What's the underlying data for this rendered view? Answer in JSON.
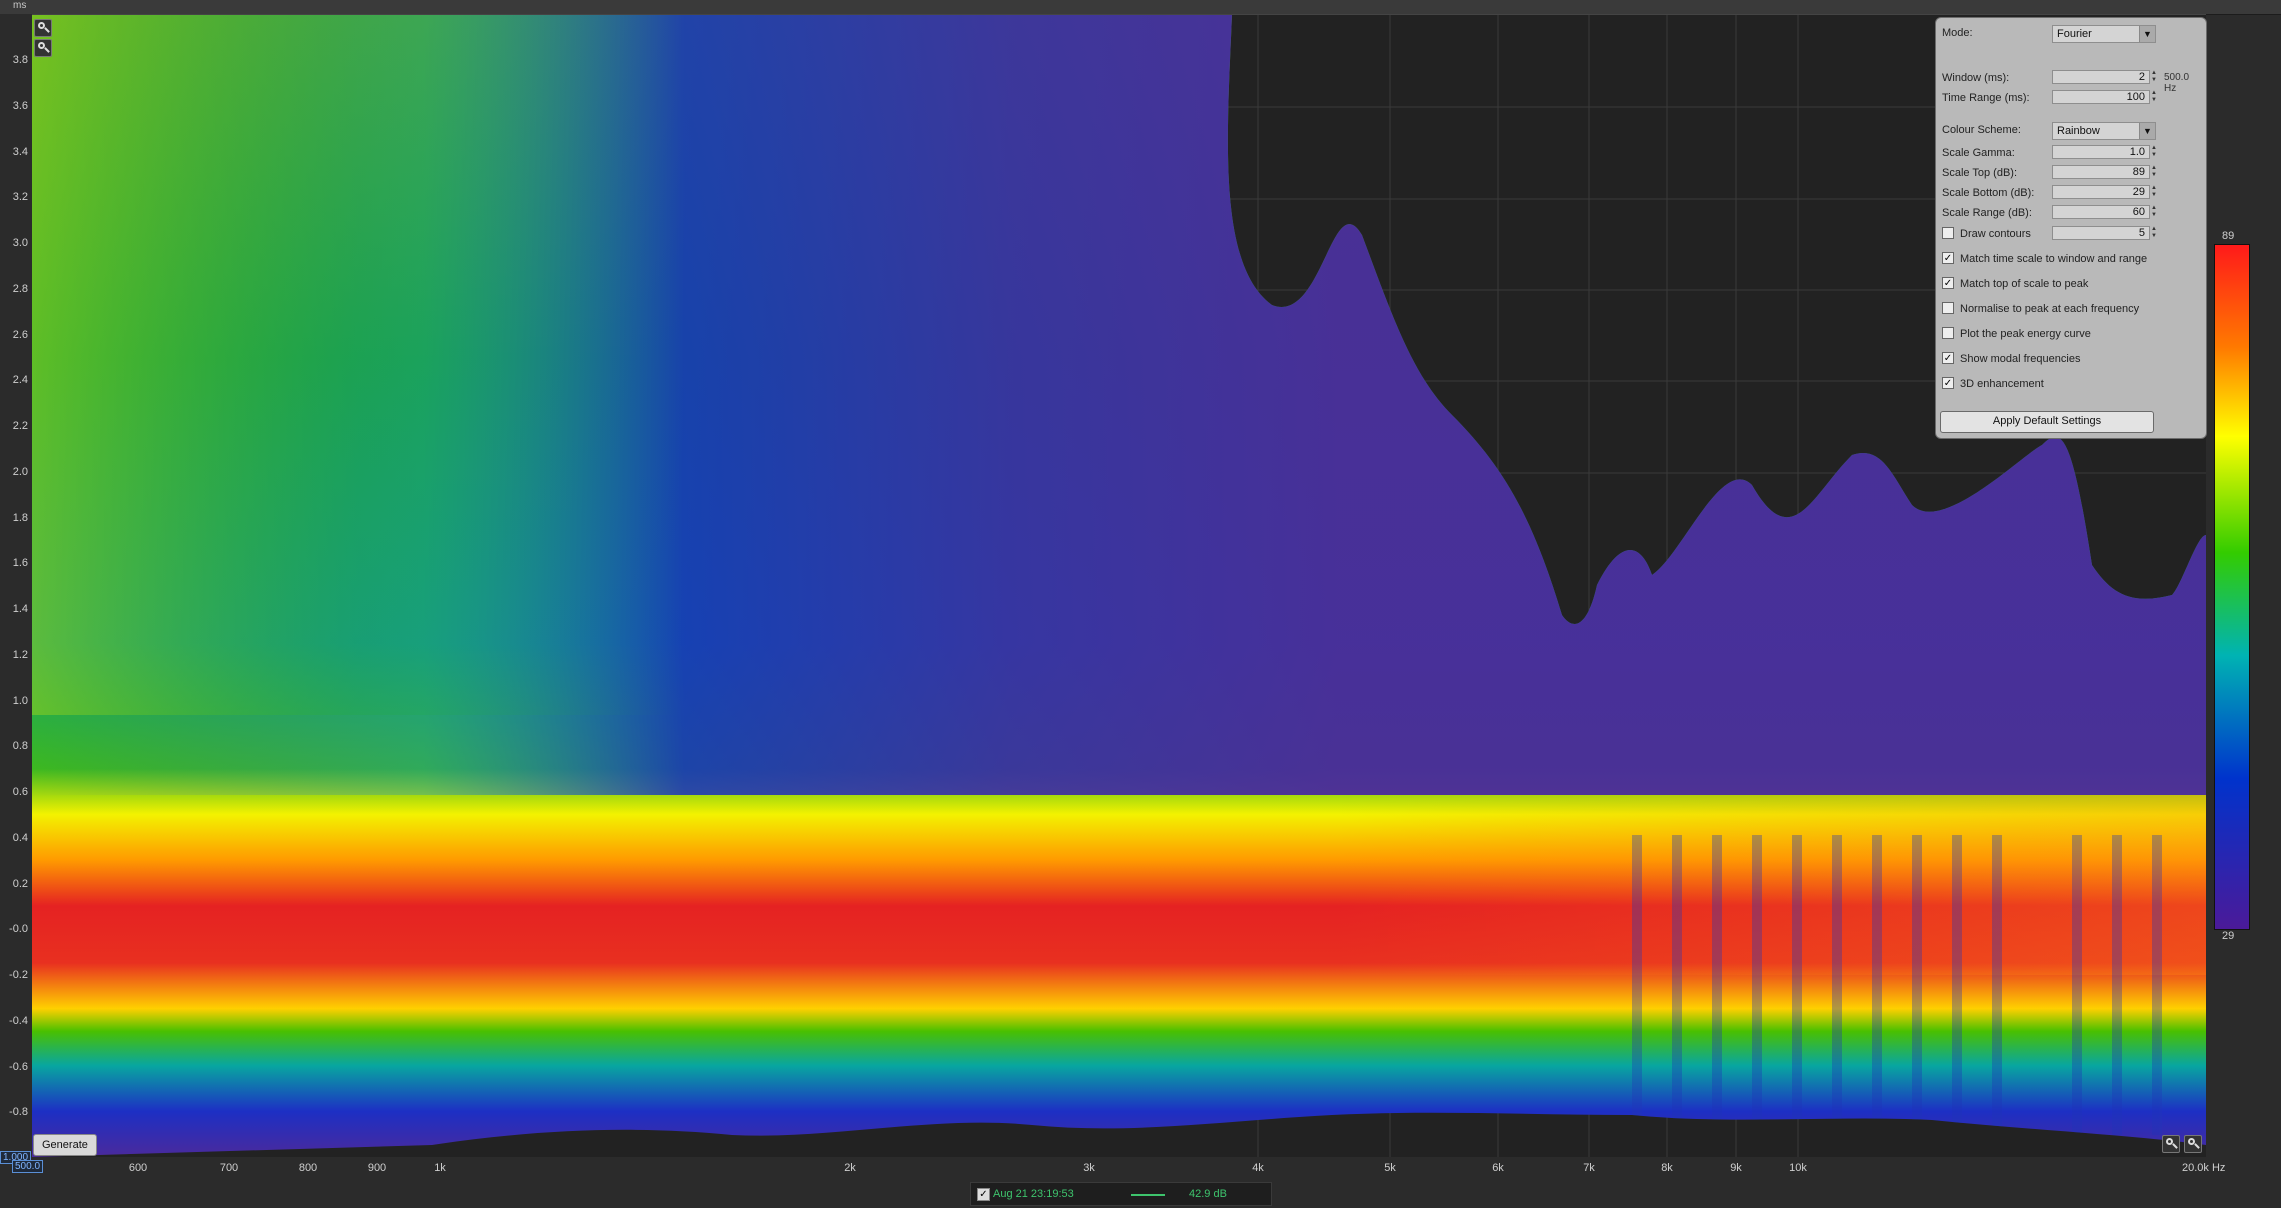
{
  "axes": {
    "y_unit": "ms",
    "y_ticks": [
      "3.8",
      "3.6",
      "3.4",
      "3.2",
      "3.0",
      "2.8",
      "2.6",
      "2.4",
      "2.2",
      "2.0",
      "1.8",
      "1.6",
      "1.4",
      "1.2",
      "1.0",
      "0.8",
      "0.6",
      "0.4",
      "0.2",
      "-0.0",
      "-0.2",
      "-0.4",
      "-0.6",
      "-0.8"
    ],
    "y_min_label": "1.000",
    "x_min_label": "500.0",
    "x_ticks": [
      "600",
      "700",
      "800",
      "900",
      "1k",
      "2k",
      "3k",
      "4k",
      "5k",
      "6k",
      "7k",
      "8k",
      "9k",
      "10k",
      "20.0k Hz"
    ]
  },
  "controls": {
    "generate_label": "Generate"
  },
  "status": {
    "timestamp": "Aug 21 23:19:53",
    "level": "42.9 dB",
    "check": "✓",
    "line_color": "#3ec46d"
  },
  "colorbar": {
    "top_label": "89",
    "bottom_label": "29"
  },
  "panel": {
    "mode_label": "Mode:",
    "mode_value": "Fourier",
    "window_label": "Window (ms):",
    "window_value": "2",
    "window_freq": "500.0 Hz",
    "time_range_label": "Time Range (ms):",
    "time_range_value": "100",
    "colour_scheme_label": "Colour Scheme:",
    "colour_scheme_value": "Rainbow",
    "scale_gamma_label": "Scale Gamma:",
    "scale_gamma_value": "1.0",
    "scale_top_label": "Scale Top (dB):",
    "scale_top_value": "89",
    "scale_bottom_label": "Scale Bottom (dB):",
    "scale_bottom_value": "29",
    "scale_range_label": "Scale Range (dB):",
    "scale_range_value": "60",
    "draw_contours_label": "Draw contours",
    "draw_contours_value": "5",
    "checkboxes": [
      {
        "label": "Match time scale to window and range",
        "checked": "✓"
      },
      {
        "label": "Match top of scale to peak",
        "checked": "✓"
      },
      {
        "label": "Normalise to peak at each frequency",
        "checked": ""
      },
      {
        "label": "Plot the peak energy curve",
        "checked": ""
      },
      {
        "label": "Show modal frequencies",
        "checked": "✓"
      },
      {
        "label": "3D enhancement",
        "checked": "✓"
      }
    ],
    "apply_label": "Apply Default Settings"
  }
}
